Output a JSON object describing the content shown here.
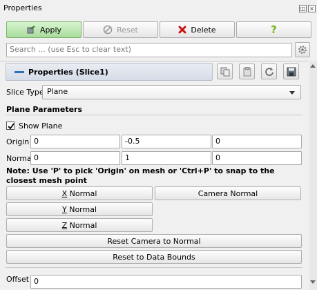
{
  "window": {
    "title": "Properties"
  },
  "toolbar": {
    "apply_label": "Apply",
    "reset_label": "Reset",
    "delete_label": "Delete",
    "help_label": "?"
  },
  "search": {
    "placeholder": "Search ... (use Esc to clear text)"
  },
  "section": {
    "title": "Properties (Slice1)"
  },
  "slice_type": {
    "label": "Slice Type",
    "value": "Plane"
  },
  "plane": {
    "heading": "Plane Parameters",
    "show_plane_label": "Show Plane",
    "show_plane_checked": true,
    "origin_label": "Origin",
    "origin": [
      "0",
      "-0.5",
      "0"
    ],
    "normal_label": "Normal",
    "normal": [
      "0",
      "1",
      "0"
    ],
    "note": "Note: Use 'P' to pick 'Origin' on mesh or 'Ctrl+P' to snap to the closest mesh point"
  },
  "buttons": {
    "x_normal": {
      "mnemonic": "X",
      "rest": " Normal"
    },
    "y_normal": {
      "mnemonic": "Y",
      "rest": " Normal"
    },
    "z_normal": {
      "mnemonic": "Z",
      "rest": " Normal"
    },
    "camera_normal": "Camera Normal",
    "reset_camera": "Reset Camera to Normal",
    "reset_bounds": "Reset to Data Bounds"
  },
  "offset": {
    "label": "Offset",
    "value": "0"
  },
  "colors": {
    "apply_bg": "#b7e4aa",
    "delete_icon": "#cc1111",
    "help_icon": "#7ab317",
    "section_bar": "#dde3ec"
  }
}
